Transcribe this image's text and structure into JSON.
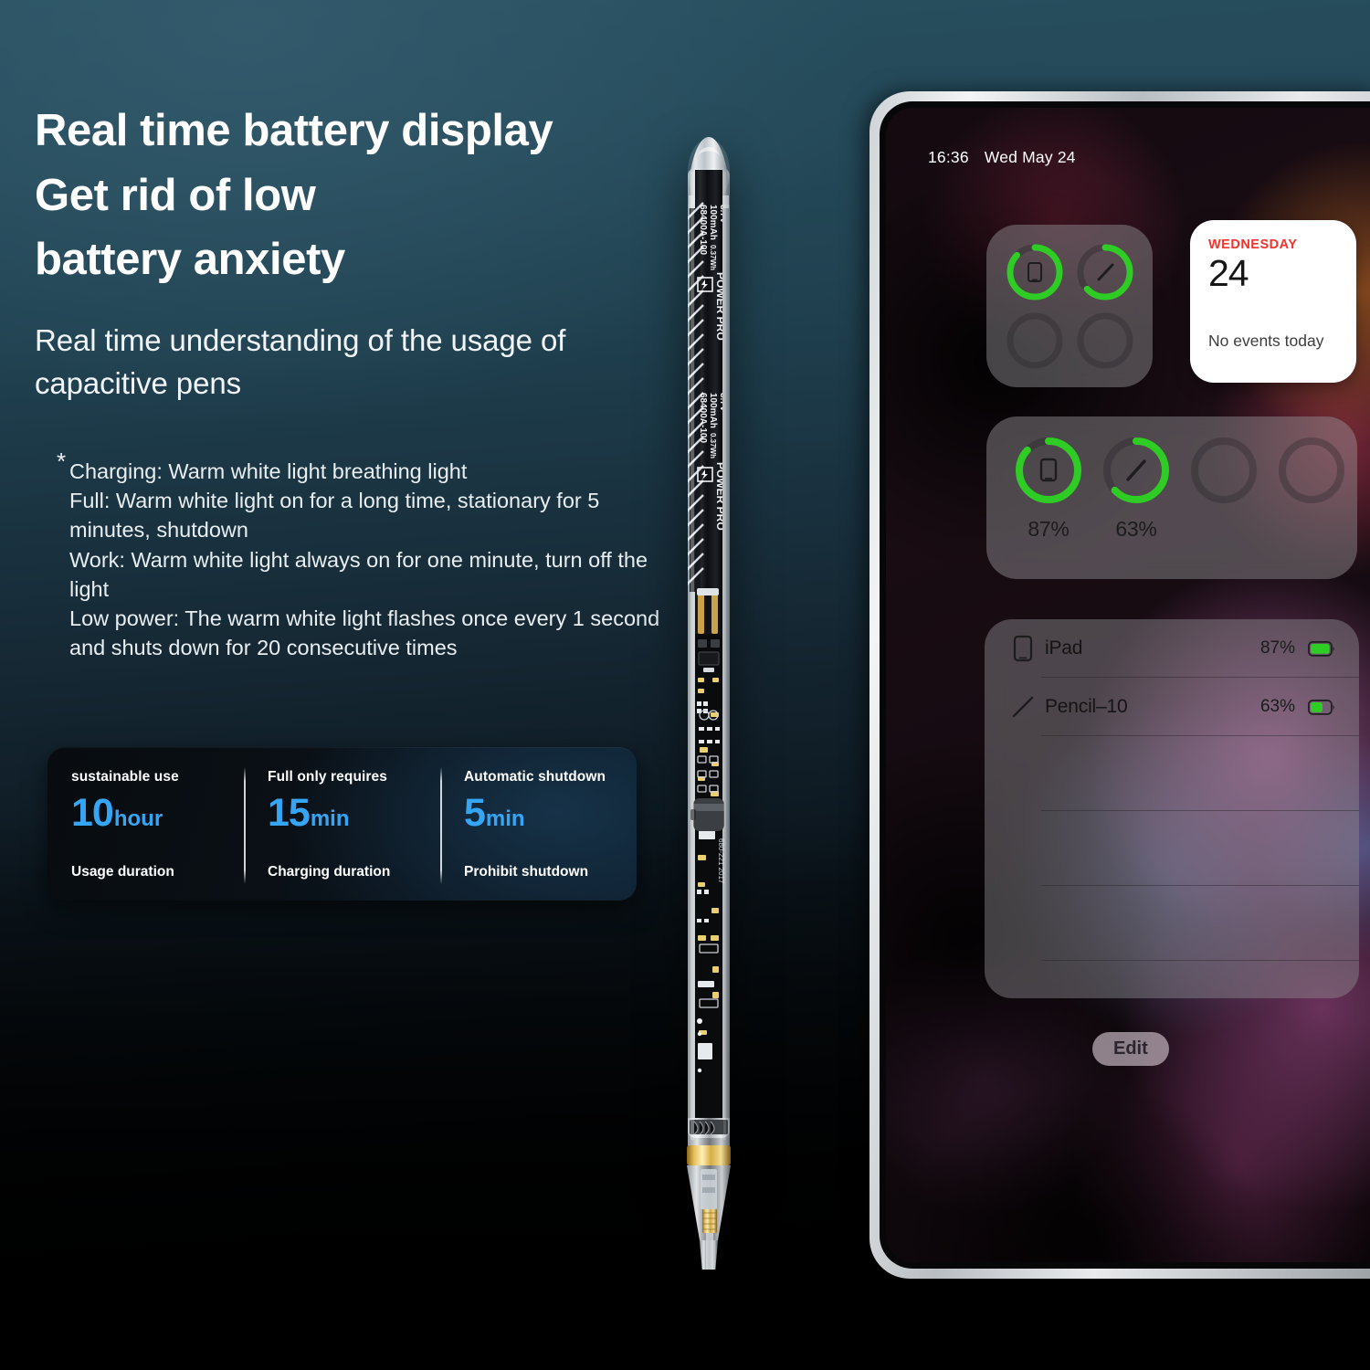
{
  "headline": {
    "line1": "Real time battery display",
    "line2": "Get rid of low",
    "line3": "battery anxiety"
  },
  "subhead": "Real time understanding of the usage of capacitive pens",
  "notes": {
    "marker": "*",
    "lines": [
      "Charging: Warm white light breathing light",
      "Full: Warm white light on for a long time, stationary for 5 minutes, shutdown",
      "Work: Warm white light always on for one minute, turn off the light",
      "Low power: The warm white light flashes once every 1 second and shuts down for 20 consecutive times"
    ]
  },
  "stats": [
    {
      "top": "sustainable use",
      "num": "10",
      "unit": "hour",
      "bottom": "Usage duration"
    },
    {
      "top": "Full only requires",
      "num": "15",
      "unit": "min",
      "bottom": "Charging duration"
    },
    {
      "top": "Automatic shutdown",
      "num": "5",
      "unit": "min",
      "bottom": "Prohibit shutdown"
    }
  ],
  "accent_blue": "#35a6f5",
  "battery_green": "#2ecc24",
  "calendar_red": "#f5322c",
  "tablet": {
    "status": {
      "time": "16:36",
      "date": "Wed May 24"
    },
    "calendar_widget": {
      "weekday": "WEDNESDAY",
      "day": "24",
      "events": "No events today"
    },
    "battery_grid_widget": {
      "rings": [
        {
          "device": "ipad",
          "percent": 87,
          "active": true
        },
        {
          "device": "pencil",
          "percent": 63,
          "active": true
        },
        {
          "device": "empty",
          "percent": 0,
          "active": false
        },
        {
          "device": "empty",
          "percent": 0,
          "active": false
        }
      ]
    },
    "battery_wide_widget": {
      "cells": [
        {
          "device": "ipad",
          "percent": 87,
          "label": "87%",
          "active": true
        },
        {
          "device": "pencil",
          "percent": 63,
          "label": "63%",
          "active": true
        },
        {
          "device": "empty",
          "percent": 0,
          "label": "",
          "active": false
        },
        {
          "device": "empty",
          "percent": 0,
          "label": "",
          "active": false
        }
      ]
    },
    "battery_list_widget": {
      "rows": [
        {
          "icon": "ipad-icon",
          "name": "iPad",
          "percent": "87%",
          "fill": 87
        },
        {
          "icon": "pencil-icon",
          "name": "Pencil–10",
          "percent": "63%",
          "fill": 63
        },
        {
          "icon": "",
          "name": "",
          "percent": "",
          "fill": 0
        },
        {
          "icon": "",
          "name": "",
          "percent": "",
          "fill": 0
        },
        {
          "icon": "",
          "name": "",
          "percent": "",
          "fill": 0
        }
      ]
    },
    "edit_button": "Edit"
  },
  "pen": {
    "battery_label_1": "POWER PRO",
    "battery_label_2": "68400A-100",
    "battery_label_3": "100mAh",
    "battery_label_4": "0.37Wh",
    "battery_label_5": "3.7V",
    "pcb_code": "680-221 2017"
  }
}
